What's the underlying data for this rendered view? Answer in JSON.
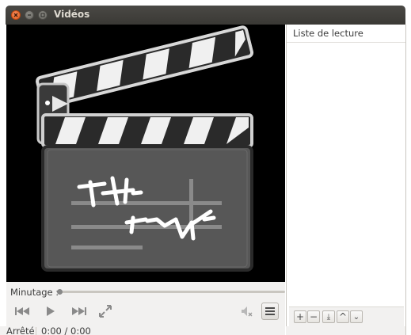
{
  "window": {
    "title": "Vidéos"
  },
  "playlist": {
    "header": "Liste de lecture",
    "tools": [
      {
        "name": "add",
        "label": "+"
      },
      {
        "name": "remove",
        "label": "−"
      },
      {
        "name": "save",
        "label": "⤓"
      },
      {
        "name": "move-up",
        "label": "^"
      },
      {
        "name": "move-down",
        "label": "⌄"
      }
    ]
  },
  "controls": {
    "seek_label": "Minutage :",
    "seek_position": 0
  },
  "status": {
    "state": "Arrêté",
    "time": "0:00 / 0:00"
  },
  "colors": {
    "titlebar": "#3c3b37",
    "close_button": "#e95420",
    "video_bg": "#000000"
  },
  "icons": [
    "close-icon",
    "minimize-icon",
    "maximize-icon",
    "previous-icon",
    "play-icon",
    "next-icon",
    "fullscreen-icon",
    "volume-muted-icon",
    "playlist-toggle-icon",
    "clapperboard-icon"
  ]
}
